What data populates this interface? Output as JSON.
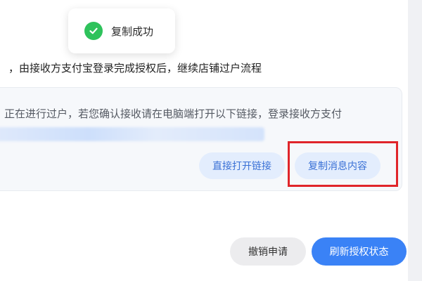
{
  "toast": {
    "icon": "check-circle-icon",
    "text": "复制成功",
    "icon_color": "#2ec25b"
  },
  "instruction": {
    "text": "，由接收方支付宝登录完成授权后，继续店铺过户流程"
  },
  "message_card": {
    "text": "正在进行过户，若您确认接收请在电脑端打开以下链接，登录接收方支付",
    "link_blurred": true,
    "open_link_label": "直接打开链接",
    "copy_message_label": "复制消息内容"
  },
  "annotation": {
    "highlight_color": "#e0252a",
    "target": "copy_message_label"
  },
  "footer": {
    "cancel_label": "撤销申请",
    "refresh_label": "刷新授权状态"
  },
  "colors": {
    "accent": "#3a82f6",
    "light_button_bg": "#e3edfd",
    "light_button_text": "#3a71d6"
  }
}
